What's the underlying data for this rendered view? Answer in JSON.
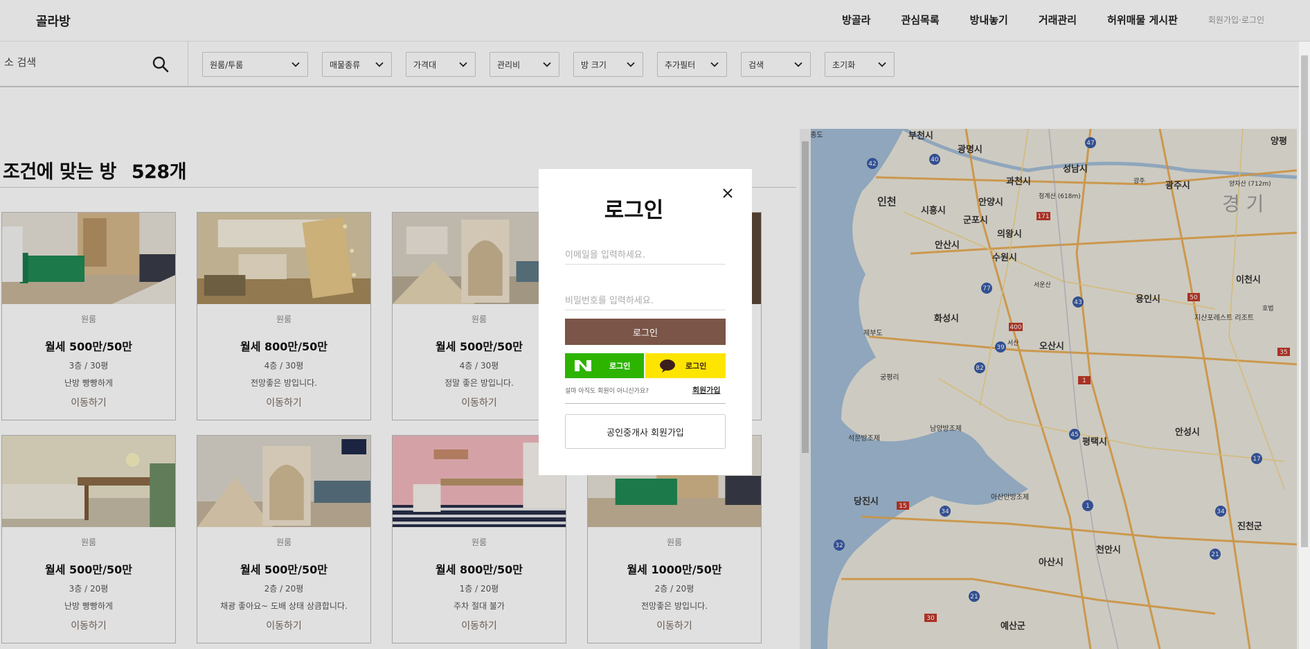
{
  "header": {
    "logo": "골라방",
    "nav": [
      "방골라",
      "관심목록",
      "방내놓기",
      "거래관리",
      "허위매물 게시판"
    ],
    "auth": "회원가입·로그인"
  },
  "search": {
    "placeholder": "소 검색"
  },
  "filters": [
    "원룸/투룸",
    "매물종류",
    "가격대",
    "관리비",
    "방 크기",
    "추가필터",
    "검색",
    "초기화"
  ],
  "listing": {
    "title": "조건에 맞는 방",
    "count": "528개"
  },
  "cards": [
    {
      "type": "원룸",
      "price": "월세 500만/50만",
      "floor": "3층 / 30평",
      "desc": "난방 빵빵하게",
      "go": "이동하기"
    },
    {
      "type": "원룸",
      "price": "월세 800만/50만",
      "floor": "4층 / 30평",
      "desc": "전망좋은 방입니다.",
      "go": "이동하기"
    },
    {
      "type": "원룸",
      "price": "월세 500만/50만",
      "floor": "4층 / 30평",
      "desc": "정말 좋은 방입니다.",
      "go": "이동하기"
    },
    {
      "type": "원룸",
      "price": "월세 500만/50만",
      "floor": "3층 / 20평",
      "desc": "난방 빵빵하게",
      "go": "이동하기"
    },
    {
      "type": "원룸",
      "price": "월세 500만/50만",
      "floor": "2층 / 20평",
      "desc": "채광 좋아요~ 도배 상태 상큼합니다.",
      "go": "이동하기"
    },
    {
      "type": "원룸",
      "price": "월세 800만/50만",
      "floor": "1층 / 20평",
      "desc": "주차 절대 불가",
      "go": "이동하기"
    },
    {
      "type": "원룸",
      "price": "월세 1000만/50만",
      "floor": "2층 / 20평",
      "desc": "전망좋은 방입니다.",
      "go": "이동하기"
    }
  ],
  "map": {
    "labels": [
      "부천시",
      "광명시",
      "성남시",
      "인천",
      "시흥시",
      "과천시",
      "안양시",
      "광주시",
      "군포시",
      "의왕시",
      "안산시",
      "수원시",
      "용인시",
      "이천시",
      "화성시",
      "오산시",
      "제부도",
      "궁평리",
      "평택시",
      "안성시",
      "석문방조제",
      "남양방조제",
      "당진시",
      "아산만방조제",
      "천안시",
      "아산시",
      "진천군",
      "예산군",
      "지산포레스트 리조트",
      "경 기",
      "영종도",
      "청계산 (618m)",
      "양자산 (712m)",
      "양평",
      "호법",
      "서산",
      "서운산",
      "광주"
    ]
  },
  "modal": {
    "title": "로그인",
    "email_placeholder": "이메일을 입력하세요.",
    "password_placeholder": "비밀번호를 입력하세요.",
    "login_button": "로그인",
    "naver_label": "로그인",
    "kakao_label": "로그인",
    "not_member": "설마 아직도 회원이 아니신가요?",
    "signup": "회원가입",
    "agent_signup": "공인중개사 회원가입"
  },
  "colors": {
    "brand_brown": "#7a5548",
    "naver_green": "#2db400",
    "kakao_yellow": "#fee500"
  }
}
